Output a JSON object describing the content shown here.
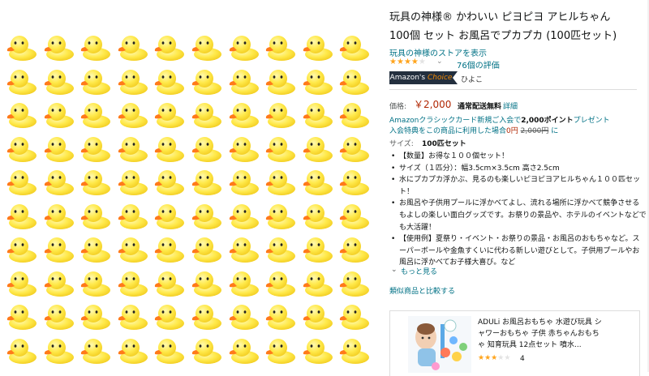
{
  "product": {
    "title_line1": "玩具の神様® かわいい ピヨピヨ アヒルちゃん",
    "title_line2": "100個 セット お風呂でプカプカ (100匹セット)",
    "store_link": "玩具の神様のストアを表示",
    "rating_stars": 4,
    "rating_count": "76個の評価",
    "badge_amazons": "Amazon's",
    "badge_choice": "Choice",
    "badge_keyword": "ひよこ",
    "price_label": "価格:",
    "price_value": "￥2,000",
    "shipping": "通常配送無料",
    "details_link": "詳細",
    "promo_line1_prefix": "Amazonクラシックカード新規ご入会で",
    "promo_points": "2,000ポイント",
    "promo_line1_suffix": "プレゼント",
    "promo_line2_prefix": "入会特典をこの商品に利用した場合",
    "promo_zero": "0円",
    "promo_strike": "2,000円",
    "promo_line2_suffix": "に",
    "size_label": "サイズ:",
    "size_value": "100匹セット",
    "bullets": [
      "【数量】お得な１００個セット！",
      "サイズ（１匹分）：幅3.5cm×3.5cm 高さ2.5cm",
      "水にプカプカ浮かぶ、見るのも楽しいピヨピヨアヒルちゃん１００匹セット！",
      "お風呂や子供用プールに浮かべてよし、流れる場所に浮かべて競争させるもよしの楽しい面白グッズです。お祭りの景品や、ホテルのイベントなどでも大活躍！",
      "【使用例】夏祭り・イベント・お祭りの景品・お風呂のおもちゃなど。スーパーボールや金魚すくいに代わる新しい遊びとして。子供用プールやお風呂に浮かべてお子様大喜び。など"
    ],
    "see_more": "もっと見る",
    "compare_link": "類似商品と比較する"
  },
  "ad": {
    "title_line1": "ADULi お風呂おもちゃ 水遊び玩具 シ",
    "title_line2": "ャワーおもちゃ 子供 赤ちゃんおもち",
    "title_line3": "ゃ 知育玩具 12点セット 噴水...",
    "rating_stars": 2.5,
    "rating_count": "4"
  },
  "colors": {
    "link": "#007185",
    "price": "#b12704",
    "star": "#ffa41c",
    "badge_bg": "#232f3e",
    "badge_accent": "#f08804",
    "duck_body": "#ffe94a",
    "duck_beak": "#ff7a1a"
  },
  "icons": {
    "rating": "star-icon",
    "dropdown": "chevron-down-icon",
    "see_more": "chevron-down-icon",
    "duck": "rubber-duck-icon"
  }
}
